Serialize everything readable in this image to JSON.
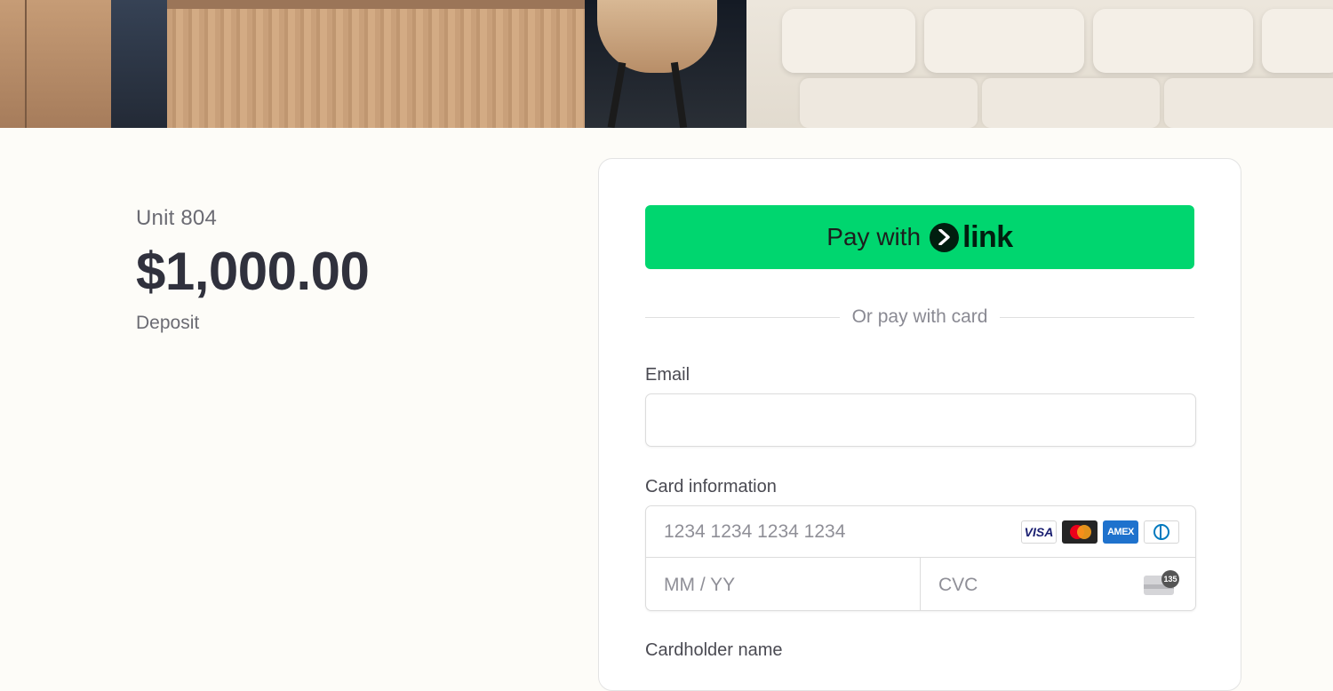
{
  "summary": {
    "unit": "Unit 804",
    "amount": "$1,000.00",
    "description": "Deposit"
  },
  "payment": {
    "link_button": {
      "prefix": "Pay with",
      "brand": "link"
    },
    "divider_text": "Or pay with card",
    "email": {
      "label": "Email",
      "value": "",
      "placeholder": ""
    },
    "card": {
      "label": "Card information",
      "number_placeholder": "1234 1234 1234 1234",
      "expiry_placeholder": "MM / YY",
      "cvc_placeholder": "CVC",
      "brands": [
        "VISA",
        "mastercard",
        "AMEX",
        "diners"
      ],
      "cvc_badge": "135"
    },
    "cardholder": {
      "label": "Cardholder name"
    }
  },
  "colors": {
    "background": "#fdfcf8",
    "link_green": "#00d66f",
    "text_primary": "#30313d",
    "text_secondary": "#6b6b73"
  }
}
